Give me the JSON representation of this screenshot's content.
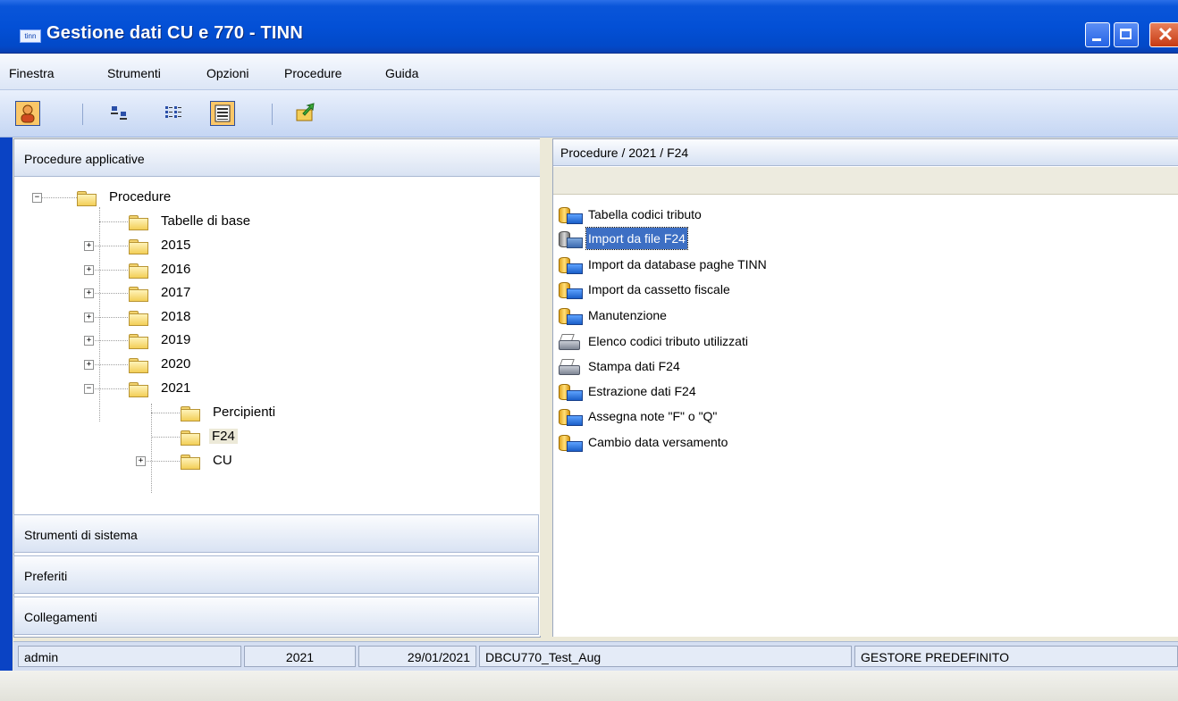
{
  "window": {
    "title": "Gestione dati CU e 770 - TINN",
    "app_icon_text": "tinn",
    "title_bar_color": "#0350D6"
  },
  "menu": [
    "Finestra",
    "Strumenti",
    "Opzioni",
    "Procedure",
    "Guida"
  ],
  "toolbar": {
    "buttons": [
      "user-icon",
      "large-icons-view-icon",
      "list-view-icon",
      "details-view-icon",
      "export-icon"
    ],
    "active": [
      "user-icon",
      "details-view-icon"
    ]
  },
  "left_panel": {
    "sections": [
      "Procedure applicative",
      "Strumenti di sistema",
      "Preferiti",
      "Collegamenti"
    ],
    "tree": {
      "root": "Procedure",
      "children": [
        "Tabelle di base",
        "2015",
        "2016",
        "2017",
        "2018",
        "2019",
        "2020",
        "2021"
      ],
      "expanded": "2021",
      "children_2021": [
        "Percipienti",
        "F24",
        "CU"
      ],
      "selected": "F24"
    }
  },
  "right_panel": {
    "path": "Procedure / 2021 / F24",
    "items": [
      {
        "label": "Tabella codici tributo",
        "icon": "database-icon"
      },
      {
        "label": "Import da file F24",
        "icon": "database-gray-icon",
        "selected": true
      },
      {
        "label": "Import da database paghe TINN",
        "icon": "database-icon"
      },
      {
        "label": "Import da cassetto fiscale",
        "icon": "database-icon"
      },
      {
        "label": "Manutenzione",
        "icon": "database-icon"
      },
      {
        "label": "Elenco codici tributo utilizzati",
        "icon": "printer-icon"
      },
      {
        "label": "Stampa dati F24",
        "icon": "printer-icon"
      },
      {
        "label": "Estrazione dati F24",
        "icon": "database-icon"
      },
      {
        "label": "Assegna note \"F\" o \"Q\"",
        "icon": "database-icon"
      },
      {
        "label": "Cambio data versamento",
        "icon": "database-icon"
      }
    ],
    "selection_color": "#3D6FC4"
  },
  "status_bar": {
    "user": "admin",
    "year": "2021",
    "date": "29/01/2021",
    "database": "DBCU770_Test_Aug",
    "manager": "GESTORE PREDEFINITO"
  }
}
